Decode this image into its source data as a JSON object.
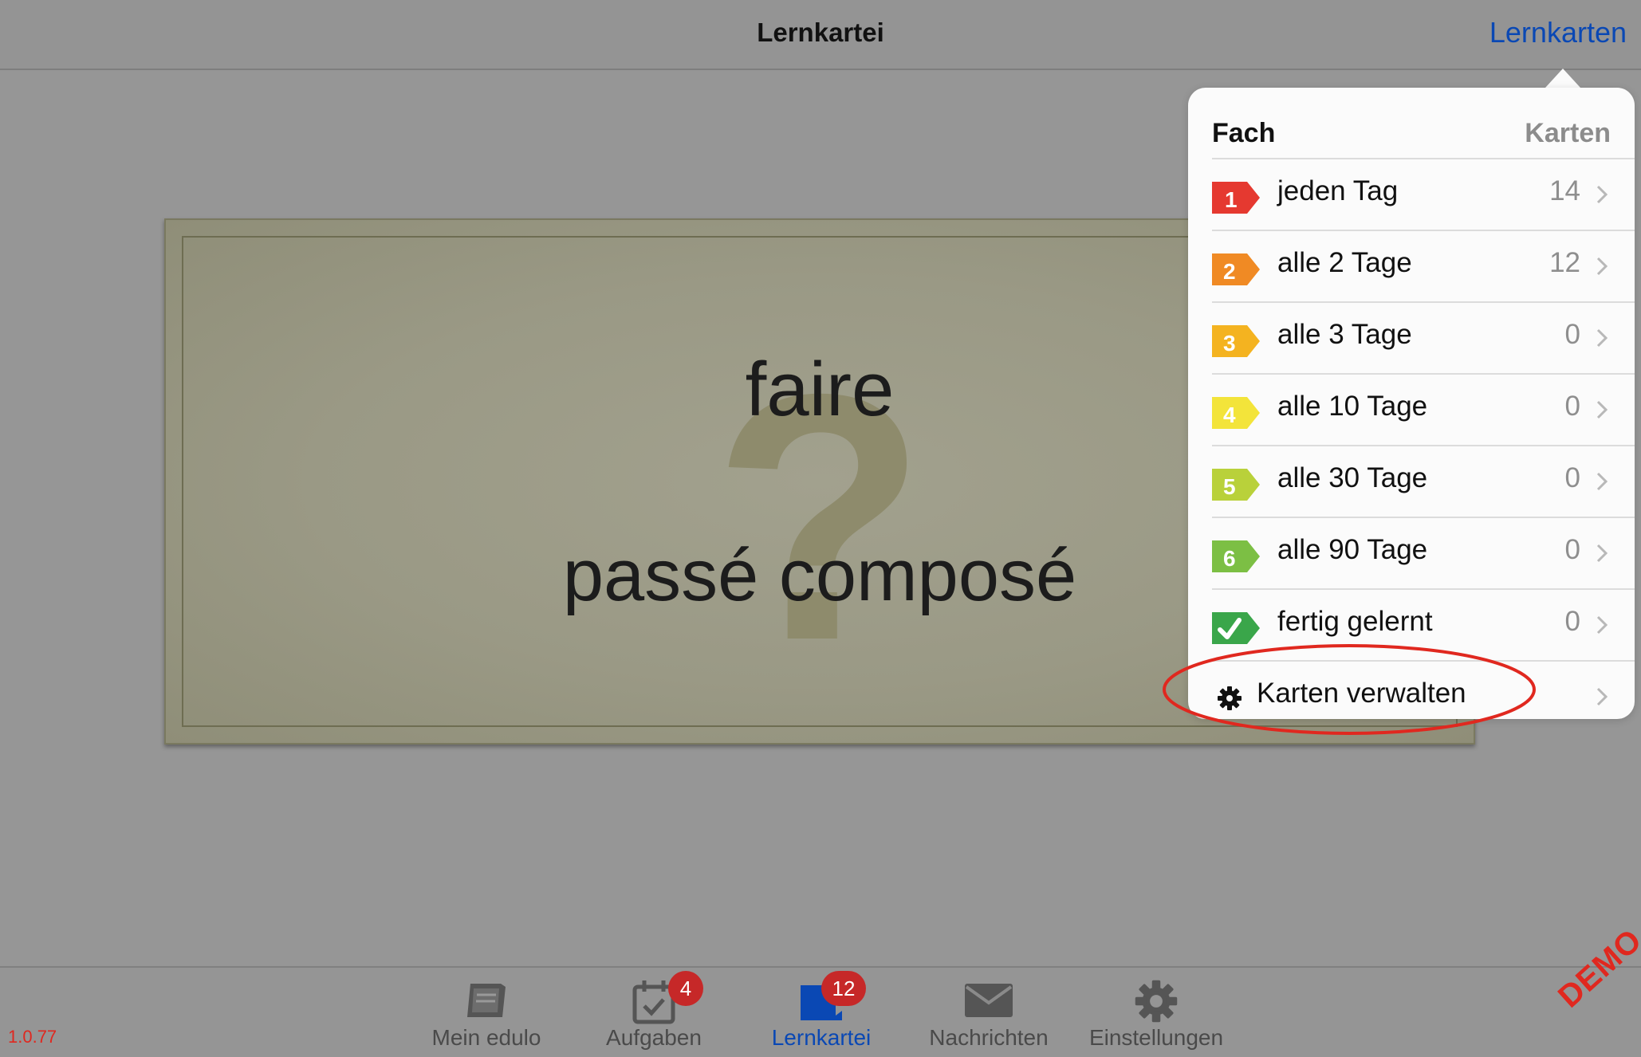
{
  "navbar": {
    "title": "Lernkartei",
    "right_button": "Lernkarten"
  },
  "card": {
    "word": "faire",
    "tense": "passé composé",
    "watermark": "?"
  },
  "popover": {
    "header_left": "Fach",
    "header_right": "Karten",
    "rows": [
      {
        "badge": "1",
        "label": "jeden Tag",
        "count": "14",
        "color": "#e53930"
      },
      {
        "badge": "2",
        "label": "alle 2 Tage",
        "count": "12",
        "color": "#f08a24"
      },
      {
        "badge": "3",
        "label": "alle 3 Tage",
        "count": "0",
        "color": "#f4b320"
      },
      {
        "badge": "4",
        "label": "alle 10 Tage",
        "count": "0",
        "color": "#f3e43a"
      },
      {
        "badge": "5",
        "label": "alle 30 Tage",
        "count": "0",
        "color": "#b9d13a"
      },
      {
        "badge": "6",
        "label": "alle 90 Tage",
        "count": "0",
        "color": "#7cbf44"
      },
      {
        "badge": "check",
        "label": "fertig gelernt",
        "count": "0",
        "color": "#3aa64a"
      }
    ],
    "manage_label": "Karten verwalten",
    "highlight_color": "#e0281f"
  },
  "tabbar": {
    "tabs": [
      {
        "label": "Mein edulo",
        "icon": "book-icon",
        "badge": ""
      },
      {
        "label": "Aufgaben",
        "icon": "calendar-check-icon",
        "badge": "4"
      },
      {
        "label": "Lernkartei",
        "icon": "flashcards-icon",
        "badge": "12"
      },
      {
        "label": "Nachrichten",
        "icon": "envelope-icon",
        "badge": ""
      },
      {
        "label": "Einstellungen",
        "icon": "gear-icon",
        "badge": ""
      }
    ],
    "active_tab": "Lernkartei",
    "accent": "#0a48b4"
  },
  "footer": {
    "version": "1.0.77",
    "demo_label": "DEMO"
  }
}
